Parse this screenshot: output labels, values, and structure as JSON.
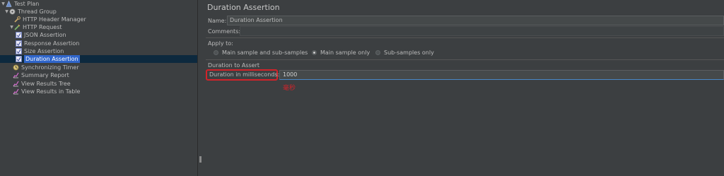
{
  "tree": {
    "items": [
      {
        "label": "Test Plan",
        "icon": "test-plan-icon"
      },
      {
        "label": "Thread Group",
        "icon": "gear-icon"
      },
      {
        "label": "HTTP Header Manager",
        "icon": "wrench-icon"
      },
      {
        "label": "HTTP Request",
        "icon": "pencil-icon"
      },
      {
        "label": "JSON Assertion",
        "icon": "assertion-icon"
      },
      {
        "label": "Response Assertion",
        "icon": "assertion-icon"
      },
      {
        "label": "Size Assertion",
        "icon": "assertion-icon"
      },
      {
        "label": "Duration Assertion",
        "icon": "assertion-icon"
      },
      {
        "label": "Synchronizing Timer",
        "icon": "timer-icon"
      },
      {
        "label": "Summary Report",
        "icon": "chart-icon"
      },
      {
        "label": "View Results Tree",
        "icon": "chart-icon"
      },
      {
        "label": "View Results in Table",
        "icon": "chart-icon"
      }
    ],
    "selected": "Duration Assertion"
  },
  "panel": {
    "title": "Duration Assertion",
    "name_label": "Name:",
    "name_value": "Duration Assertion",
    "comments_label": "Comments:",
    "apply_to_label": "Apply to:",
    "apply_options": [
      {
        "label": "Main sample and sub-samples",
        "selected": false
      },
      {
        "label": "Main sample only",
        "selected": true
      },
      {
        "label": "Sub-samples only",
        "selected": false
      }
    ],
    "duration_section": "Duration to Assert",
    "duration_label": "Duration in milliseconds:",
    "duration_value": "1000",
    "annotation": "毫秒"
  },
  "colors": {
    "background": "#3c3f41",
    "selection": "#2f65ca",
    "annotation_red": "#d2232a",
    "input_focus": "#4a88c7"
  }
}
